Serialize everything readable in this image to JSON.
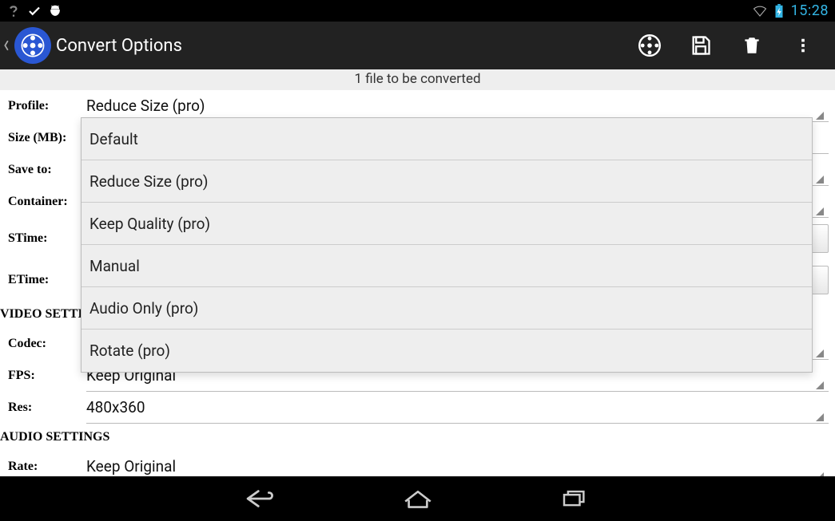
{
  "statusbar": {
    "time": "15:28"
  },
  "actionbar": {
    "title": "Convert Options"
  },
  "summary": "1 file to be converted",
  "form": {
    "profile": {
      "label": "Profile:",
      "value": "Reduce Size (pro)"
    },
    "size": {
      "label": "Size (MB):",
      "value": ""
    },
    "saveto": {
      "label": "Save to:",
      "value": ""
    },
    "container": {
      "label": "Container:",
      "value": ""
    },
    "stime": {
      "label": "STime:",
      "value": ""
    },
    "etime": {
      "label": "ETime:",
      "value": ""
    },
    "video_header": "VIDEO SETTINGS",
    "codec": {
      "label": "Codec:",
      "value": ""
    },
    "fps": {
      "label": "FPS:",
      "value": "Keep Original"
    },
    "res": {
      "label": "Res:",
      "value": "480x360"
    },
    "audio_header": "AUDIO SETTINGS",
    "rate": {
      "label": "Rate:",
      "value": "Keep Original"
    }
  },
  "profile_options": [
    "Default",
    "Reduce Size (pro)",
    "Keep Quality (pro)",
    "Manual",
    "Audio Only (pro)",
    "Rotate (pro)"
  ]
}
